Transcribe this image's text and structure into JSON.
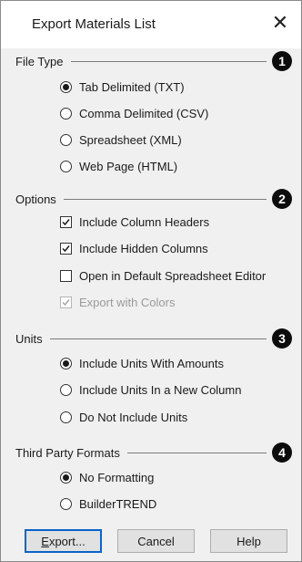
{
  "dialog": {
    "title": "Export Materials List",
    "close_glyph": "✕"
  },
  "sections": {
    "file_type": {
      "label": "File Type",
      "badge": "1",
      "options": [
        {
          "label": "Tab Delimited (TXT)",
          "selected": true
        },
        {
          "label": "Comma Delimited (CSV)",
          "selected": false
        },
        {
          "label": "Spreadsheet (XML)",
          "selected": false
        },
        {
          "label": "Web Page (HTML)",
          "selected": false
        }
      ]
    },
    "options": {
      "label": "Options",
      "badge": "2",
      "items": [
        {
          "label": "Include Column Headers",
          "checked": true,
          "enabled": true
        },
        {
          "label": "Include Hidden Columns",
          "checked": true,
          "enabled": true
        },
        {
          "label": "Open in Default Spreadsheet Editor",
          "checked": false,
          "enabled": true
        },
        {
          "label": "Export with Colors",
          "checked": true,
          "enabled": false
        }
      ]
    },
    "units": {
      "label": "Units",
      "badge": "3",
      "options": [
        {
          "label": "Include Units With Amounts",
          "selected": true
        },
        {
          "label": "Include Units In a New Column",
          "selected": false
        },
        {
          "label": "Do Not Include Units",
          "selected": false
        }
      ]
    },
    "third_party": {
      "label": "Third Party Formats",
      "badge": "4",
      "options": [
        {
          "label": "No Formatting",
          "selected": true
        },
        {
          "label": "BuilderTREND",
          "selected": false
        }
      ]
    }
  },
  "buttons": {
    "export_mnemonic": "E",
    "export_rest": "xport...",
    "cancel": "Cancel",
    "help": "Help"
  },
  "colors": {
    "dialog_bg": "#f0f0f0",
    "default_button_border": "#0a64c8",
    "badge_bg": "#0c0c0c"
  }
}
